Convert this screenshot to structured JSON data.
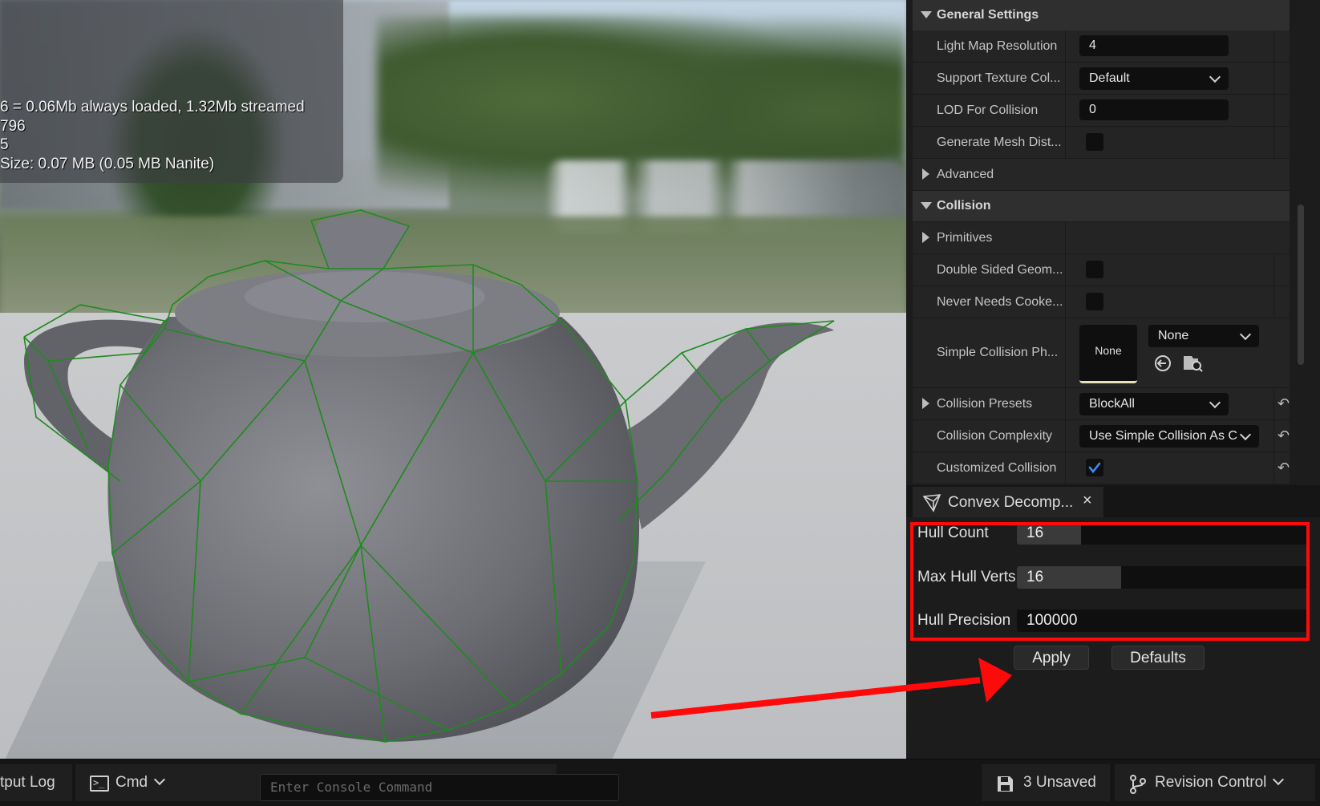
{
  "viewport": {
    "stats": [
      "6 = 0.06Mb always loaded, 1.32Mb streamed",
      "796",
      "5",
      " Size: 0.07 MB (0.05 MB Nanite)"
    ]
  },
  "details": {
    "general_settings": {
      "title": "General Settings",
      "light_map_resolution": {
        "label": "Light Map Resolution",
        "value": "4"
      },
      "support_texture": {
        "label": "Support Texture Col...",
        "value": "Default"
      },
      "lod_for_collision": {
        "label": "LOD For Collision",
        "value": "0"
      },
      "generate_mesh_dist": {
        "label": "Generate Mesh Dist..."
      }
    },
    "advanced": {
      "label": "Advanced"
    },
    "collision": {
      "title": "Collision",
      "primitives": {
        "label": "Primitives"
      },
      "double_sided": {
        "label": "Double Sided Geom..."
      },
      "never_needs_cooked": {
        "label": "Never Needs Cooke..."
      },
      "simple_collision_ph": {
        "label": "Simple Collision Ph...",
        "thumb_label": "None",
        "value": "None"
      },
      "collision_presets": {
        "label": "Collision Presets",
        "value": "BlockAll"
      },
      "collision_complexity": {
        "label": "Collision Complexity",
        "value": "Use Simple Collision As C"
      },
      "customized_collision": {
        "label": "Customized Collision",
        "checked": true
      }
    }
  },
  "convex": {
    "tab_title": "Convex Decomp...",
    "close_symbol": "×",
    "hull_count": {
      "label": "Hull Count",
      "value": "16",
      "fill": 0.22
    },
    "max_hull_verts": {
      "label": "Max Hull Verts",
      "value": "16",
      "fill": 0.36
    },
    "hull_precision": {
      "label": "Hull Precision",
      "value": "100000",
      "fill": 0.0
    },
    "apply_label": "Apply",
    "defaults_label": "Defaults"
  },
  "bottombar": {
    "output_log": "tput Log",
    "cmd_label": "Cmd",
    "console_placeholder": "Enter Console Command",
    "unsaved": "3 Unsaved",
    "revision_control": "Revision Control"
  },
  "colors": {
    "highlight": "#ff0a0a",
    "wireframe": "#1f8a1f",
    "checkbox_check": "#3b8df5"
  }
}
